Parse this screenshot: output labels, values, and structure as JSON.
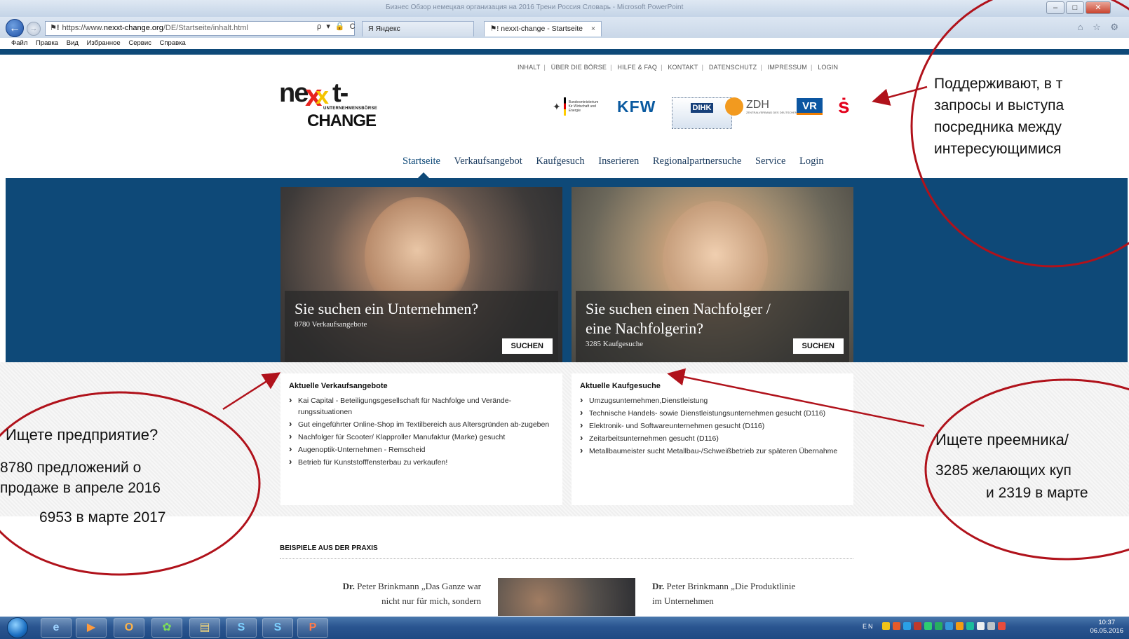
{
  "browser": {
    "window_title": "Бизнес Обзор немецкая организация на 2016 Трени Россия Словарь - Microsoft PowerPoint",
    "url_flag": "⚑!",
    "url_scheme": "https://www.",
    "url_domain": "nexxt-change.org",
    "url_path": "/DE/Startseite/inhalt.html",
    "url_tools": "ρ ▾ 🔒 C",
    "tabs": [
      {
        "label": "Я  Яндекс"
      },
      {
        "label": "⚑!  nexxt-change - Startseite",
        "close": "×"
      }
    ],
    "toolbar_icons": "⌂ ☆ ⚙",
    "window_controls": {
      "minimize": "–",
      "maximize": "□",
      "close": "✕"
    },
    "menu": [
      "Файл",
      "Правка",
      "Вид",
      "Избранное",
      "Сервис",
      "Справка"
    ]
  },
  "page": {
    "top_nav": [
      "INHALT",
      "ÜBER DIE BÖRSE",
      "HILFE & FAQ",
      "KONTAKT",
      "DATENSCHUTZ",
      "IMPRESSUM",
      "LOGIN"
    ],
    "top_nav_separator": "|",
    "logo": {
      "word1": "ne",
      "xx": "x",
      "word_t": "t-",
      "sub": "UNTERNEHMENSBÖRSE",
      "change": "CHANGE"
    },
    "sponsors": {
      "bmwi": "Bundesministerium für Wirtschaft und Energie",
      "kfw": "KFW",
      "dihk": "DIHK",
      "zdh": "ZDH",
      "zdh_sub": "ZENTRALVERBAND DES DEUTSCHEN HANDWERKS",
      "vr": "VR",
      "sparkasse": "ṡ"
    },
    "main_nav": [
      "Startseite",
      "Verkaufsangebot",
      "Kaufgesuch",
      "Inserieren",
      "Regionalpartnersuche",
      "Service",
      "Login"
    ],
    "hero_left": {
      "heading": "Sie suchen ein Unternehmen?",
      "count": "8780 Verkaufsangebote",
      "button": "SUCHEN"
    },
    "hero_right": {
      "heading_line1": "Sie suchen einen Nachfolger /",
      "heading_line2": "eine Nachfolgerin?",
      "count": "3285 Kaufgesuche",
      "button": "SUCHEN"
    },
    "list_left": {
      "title": "Aktuelle Verkaufsangebote",
      "items": [
        "Kai Capital - Beteiligungsgesellschaft für Nachfolge und Verände-rungssituationen",
        "Gut eingeführter Online-Shop im Textilbereich aus Altersgründen ab-zugeben",
        "Nachfolger für Scooter/ Klapproller Manufaktur (Marke) gesucht",
        "Augenoptik-Unternehmen - Remscheid",
        "Betrieb für Kunststofffensterbau zu verkaufen!"
      ]
    },
    "list_right": {
      "title": "Aktuelle Kaufgesuche",
      "items": [
        "Umzugsunternehmen,Dienstleistung",
        "Technische Handels- sowie Dienstleistungsunternehmen gesucht (D116)",
        "Elektronik- und Softwareunternehmen gesucht (D116)",
        "Zeitarbeitsunternehmen gesucht (D116)",
        "Metallbaumeister sucht Metallbau-/Schweißbetrieb zur späteren Übernahme"
      ]
    },
    "praxis_title": "BEISPIELE AUS DER PRAXIS",
    "quote_left_name": "Dr.",
    "quote_left": " Peter Brinkmann „Das Ganze war nicht nur für mich, sondern",
    "quote_right_name": "Dr.",
    "quote_right": " Peter Brinkmann „Die Produktlinie im Unternehmen"
  },
  "annotations": {
    "top_right": [
      "Поддерживают, в т",
      "запросы и выступа",
      "посредника между",
      "интересующимися"
    ],
    "left": [
      "Ищете предприятие?",
      "8780 предложений о",
      "продаже в апреле 2016",
      "6953 в марте 2017"
    ],
    "right": [
      "Ищете преемника/",
      "3285 желающих куп",
      "и 2319 в марте"
    ],
    "color": "#b0121b"
  },
  "taskbar": {
    "apps": [
      "e",
      "▶",
      "O",
      "✿",
      "▤",
      "S",
      "S",
      "P"
    ],
    "lang": "EN",
    "time": "10:37",
    "date": "06.05.2016"
  }
}
